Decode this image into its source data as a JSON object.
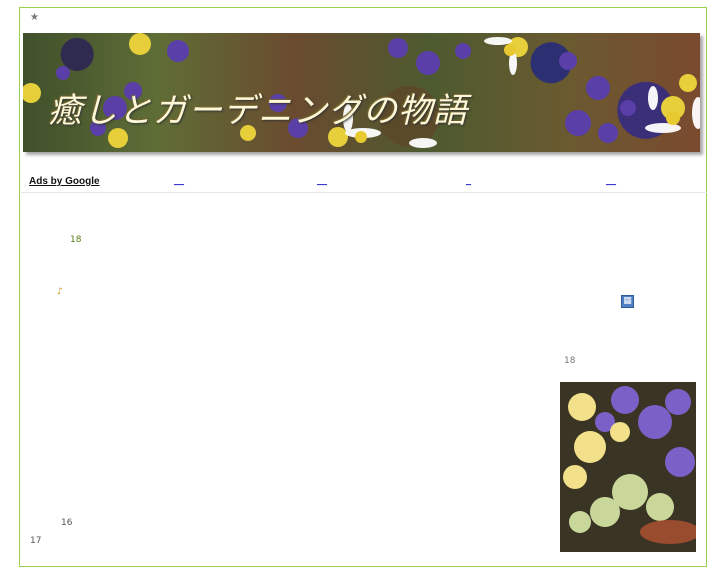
{
  "header": {
    "star": "★"
  },
  "banner": {
    "title": "癒しとガーデニングの物語"
  },
  "ads": {
    "label": "Ads by Google",
    "links": [
      "__",
      "__",
      "_",
      "__"
    ]
  },
  "left": {
    "date": "18",
    "note_icon": "♪",
    "day16": "16",
    "day17": "17"
  },
  "right": {
    "calendar_icon": "▦",
    "date": "18"
  },
  "icons": {
    "star": "star-icon",
    "note": "music-note-icon",
    "calendar": "calendar-icon"
  },
  "colors": {
    "frame_border": "#9bcf4f",
    "link": "#3a3acf",
    "date_green": "#557a15"
  }
}
